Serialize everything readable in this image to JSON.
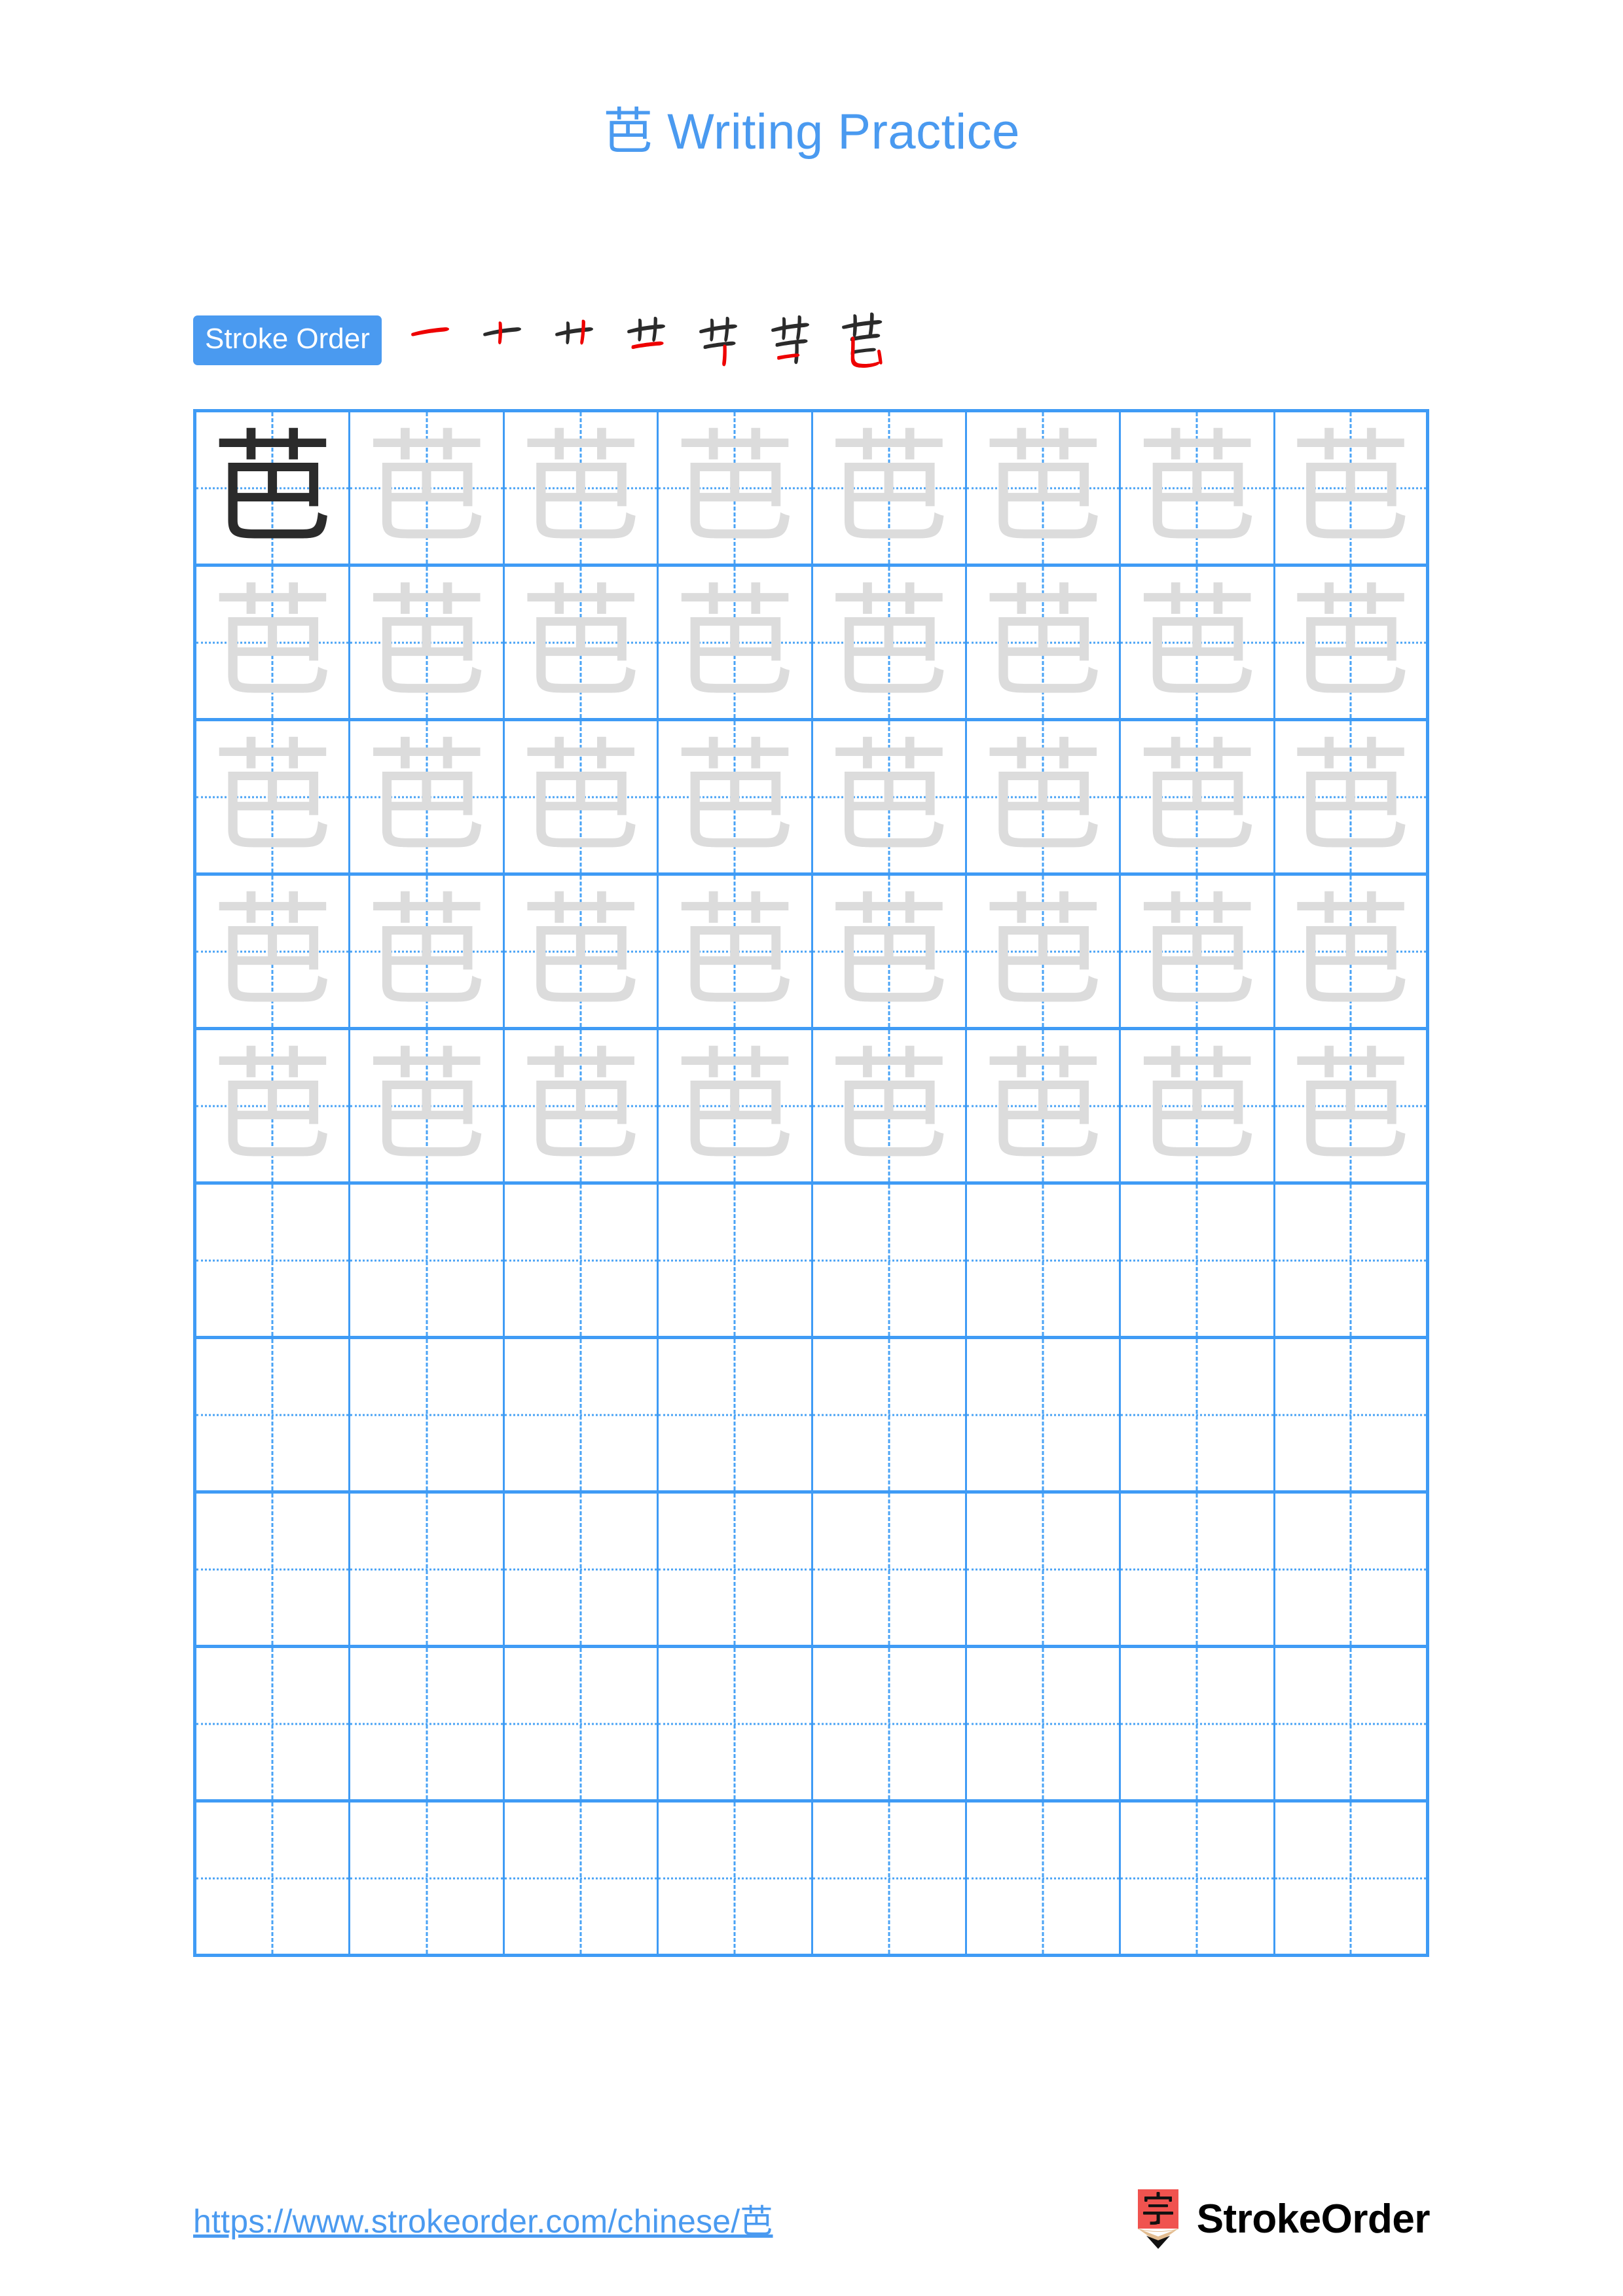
{
  "page": {
    "background": "#ffffff",
    "accent_blue": "#4a9af0",
    "grid_line_blue": "#3f9bf5",
    "trace_gray": "#dcdcdc",
    "model_black": "#2b2b2b",
    "new_stroke_red": "#ee0000"
  },
  "header": {
    "character": "芭",
    "title_suffix": " Writing Practice",
    "title_full": "芭 Writing Practice"
  },
  "stroke_order": {
    "badge_label": "Stroke Order",
    "character": "芭",
    "total_strokes": 7,
    "steps": [
      {
        "index": 1,
        "partial": "一",
        "new_stroke": "héng (horizontal)"
      },
      {
        "index": 2,
        "partial": "十",
        "new_stroke": "shù (vertical)"
      },
      {
        "index": 3,
        "partial": "艹",
        "new_stroke": "shù (vertical)"
      },
      {
        "index": 4,
        "partial": "艼",
        "new_stroke": "héng (horizontal)"
      },
      {
        "index": 5,
        "partial": "节",
        "new_stroke": "shù (vertical)"
      },
      {
        "index": 6,
        "partial": "芇",
        "new_stroke": "héng (horizontal)"
      },
      {
        "index": 7,
        "partial": "芭",
        "new_stroke": "shù wān gōu (vertical bend hook)"
      }
    ]
  },
  "practice_grid": {
    "columns": 8,
    "rows": 10,
    "character": "芭",
    "model_cell": {
      "row": 1,
      "column": 1
    },
    "filled_rows": 5,
    "empty_rows": 5,
    "cells": [
      [
        "model",
        "trace",
        "trace",
        "trace",
        "trace",
        "trace",
        "trace",
        "trace"
      ],
      [
        "trace",
        "trace",
        "trace",
        "trace",
        "trace",
        "trace",
        "trace",
        "trace"
      ],
      [
        "trace",
        "trace",
        "trace",
        "trace",
        "trace",
        "trace",
        "trace",
        "trace"
      ],
      [
        "trace",
        "trace",
        "trace",
        "trace",
        "trace",
        "trace",
        "trace",
        "trace"
      ],
      [
        "trace",
        "trace",
        "trace",
        "trace",
        "trace",
        "trace",
        "trace",
        "trace"
      ],
      [
        "blank",
        "blank",
        "blank",
        "blank",
        "blank",
        "blank",
        "blank",
        "blank"
      ],
      [
        "blank",
        "blank",
        "blank",
        "blank",
        "blank",
        "blank",
        "blank",
        "blank"
      ],
      [
        "blank",
        "blank",
        "blank",
        "blank",
        "blank",
        "blank",
        "blank",
        "blank"
      ],
      [
        "blank",
        "blank",
        "blank",
        "blank",
        "blank",
        "blank",
        "blank",
        "blank"
      ],
      [
        "blank",
        "blank",
        "blank",
        "blank",
        "blank",
        "blank",
        "blank",
        "blank"
      ]
    ]
  },
  "footer": {
    "url": "https://www.strokeorder.com/chinese/芭",
    "brand_name": "StrokeOrder",
    "brand_mark_character": "字",
    "brand_mark_icon": "pencil-icon"
  }
}
